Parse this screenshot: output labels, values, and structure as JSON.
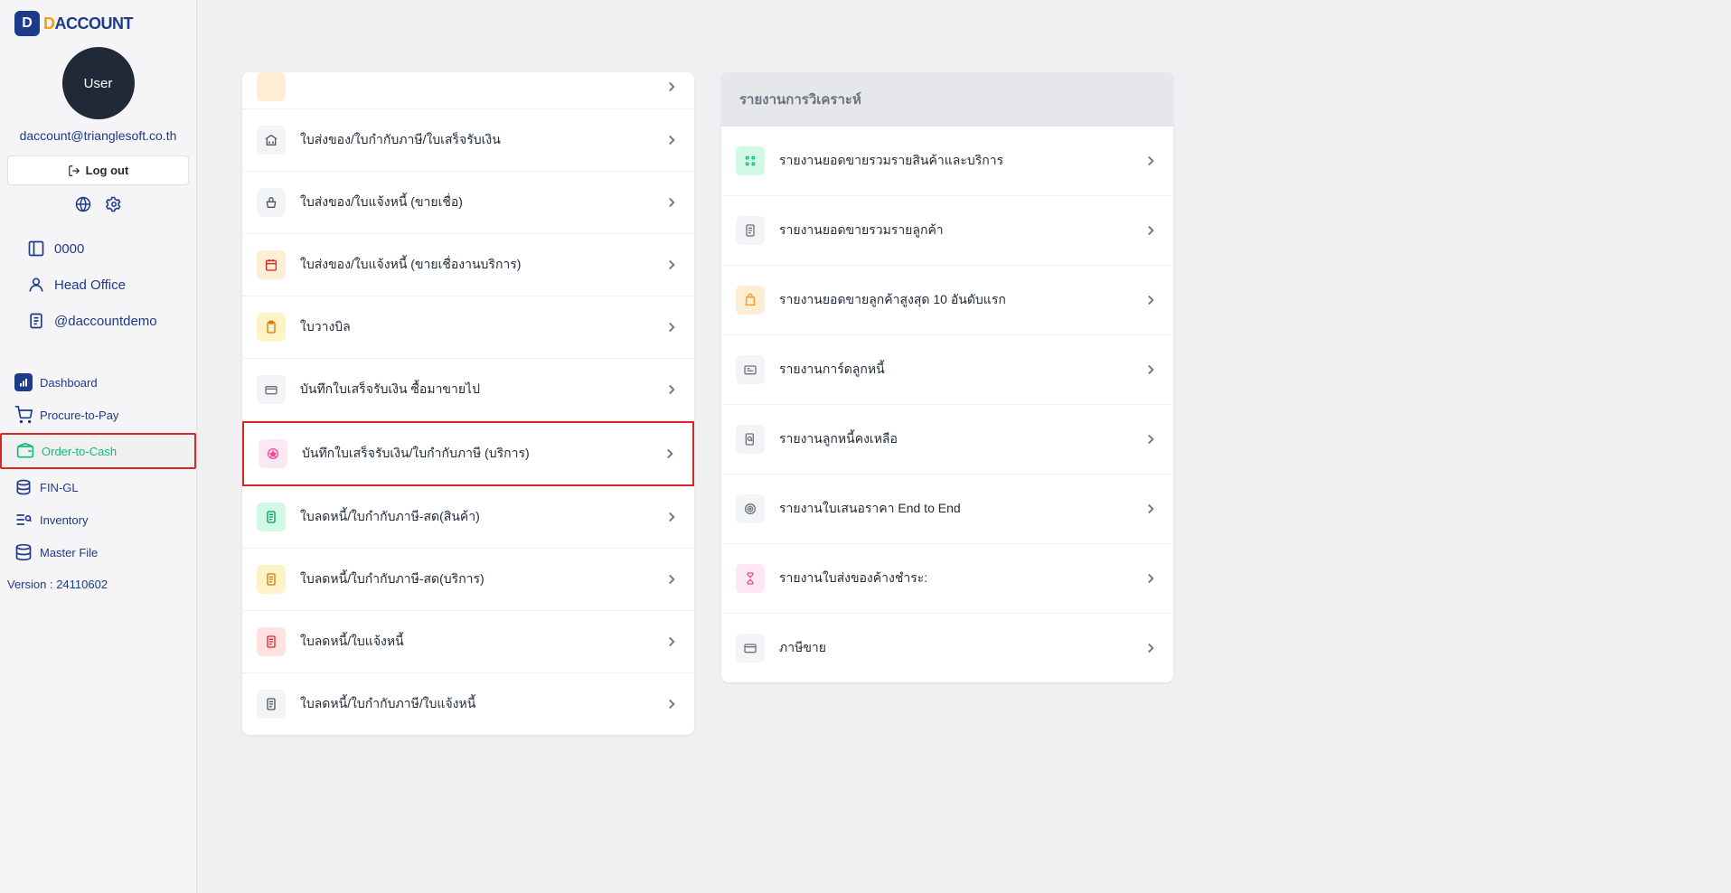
{
  "logo": {
    "letter": "D",
    "text_prefix": "D",
    "text_suffix": "ACCOUNT"
  },
  "user": {
    "avatar_label": "User",
    "email": "daccount@trianglesoft.co.th",
    "logout": "Log out"
  },
  "info": {
    "code": "0000",
    "office": "Head Office",
    "handle": "@daccountdemo"
  },
  "nav": {
    "dashboard": "Dashboard",
    "procure": "Procure-to-Pay",
    "order": "Order-to-Cash",
    "fingl": "FIN-GL",
    "inventory": "Inventory",
    "master": "Master File"
  },
  "version": "Version : 24110602",
  "menu_left": [
    {
      "label": "ใบส่งของ/ใบกำกับภาษี/ใบเสร็จรับเงิน",
      "icon": "bank",
      "bg": "bg-gray-light",
      "color": "#4b5563"
    },
    {
      "label": "ใบส่งของ/ใบแจ้งหนี้ (ขายเชื่อ)",
      "icon": "basket",
      "bg": "bg-gray-light",
      "color": "#4b5563"
    },
    {
      "label": "ใบส่งของ/ใบแจ้งหนี้ (ขายเชื่องานบริการ)",
      "icon": "calendar",
      "bg": "bg-orange-light",
      "color": "#dc2626"
    },
    {
      "label": "ใบวางบิล",
      "icon": "clipboard",
      "bg": "bg-peach",
      "color": "#d97706"
    },
    {
      "label": "บันทึกใบเสร็จรับเงิน ซื้อมาขายไป",
      "icon": "credit",
      "bg": "bg-gray-light",
      "color": "#6b7280"
    },
    {
      "label": "บันทึกใบเสร็จรับเงิน/ใบกำกับภาษี (บริการ)",
      "icon": "star",
      "bg": "bg-pink-light",
      "color": "#ec4899",
      "highlighted": true
    },
    {
      "label": "ใบลดหนี้/ใบกำกับภาษี-สด(สินค้า)",
      "icon": "doc",
      "bg": "bg-green-light",
      "color": "#059669"
    },
    {
      "label": "ใบลดหนี้/ใบกำกับภาษี-สด(บริการ)",
      "icon": "doc",
      "bg": "bg-peach",
      "color": "#d97706"
    },
    {
      "label": "ใบลดหนี้/ใบแจ้งหนี้",
      "icon": "doc",
      "bg": "bg-red-light",
      "color": "#dc2626"
    },
    {
      "label": "ใบลดหนี้/ใบกำกับภาษี/ใบแจ้งหนี้",
      "icon": "doc",
      "bg": "bg-gray-light",
      "color": "#4b5563"
    }
  ],
  "reports_header": "รายงานการวิเคราะห์",
  "reports": [
    {
      "label": "รายงานยอดขายรวมรายสินค้าและบริการ",
      "icon": "grid",
      "bg": "bg-green-light",
      "color": "#10b981"
    },
    {
      "label": "รายงานยอดขายรวมรายลูกค้า",
      "icon": "doc",
      "bg": "bg-gray-light",
      "color": "#6b7280"
    },
    {
      "label": "รายงานยอดขายลูกค้าสูงสุด 10 อันดับแรก",
      "icon": "bag",
      "bg": "bg-orange-light",
      "color": "#f59e0b"
    },
    {
      "label": "รายงานการ์ดลูกหนี้",
      "icon": "card",
      "bg": "bg-gray-light",
      "color": "#6b7280"
    },
    {
      "label": "รายงานลูกหนี้คงเหลือ",
      "icon": "search",
      "bg": "bg-gray-light",
      "color": "#6b7280"
    },
    {
      "label": "รายงานใบเสนอราคา End to End",
      "icon": "target",
      "bg": "bg-gray-light",
      "color": "#6b7280"
    },
    {
      "label": "รายงานใบส่งของค้างชำระ:",
      "icon": "hourglass",
      "bg": "bg-pink-light",
      "color": "#ec4899"
    },
    {
      "label": "ภาษีขาย",
      "icon": "card2",
      "bg": "bg-gray-light",
      "color": "#6b7280"
    }
  ]
}
